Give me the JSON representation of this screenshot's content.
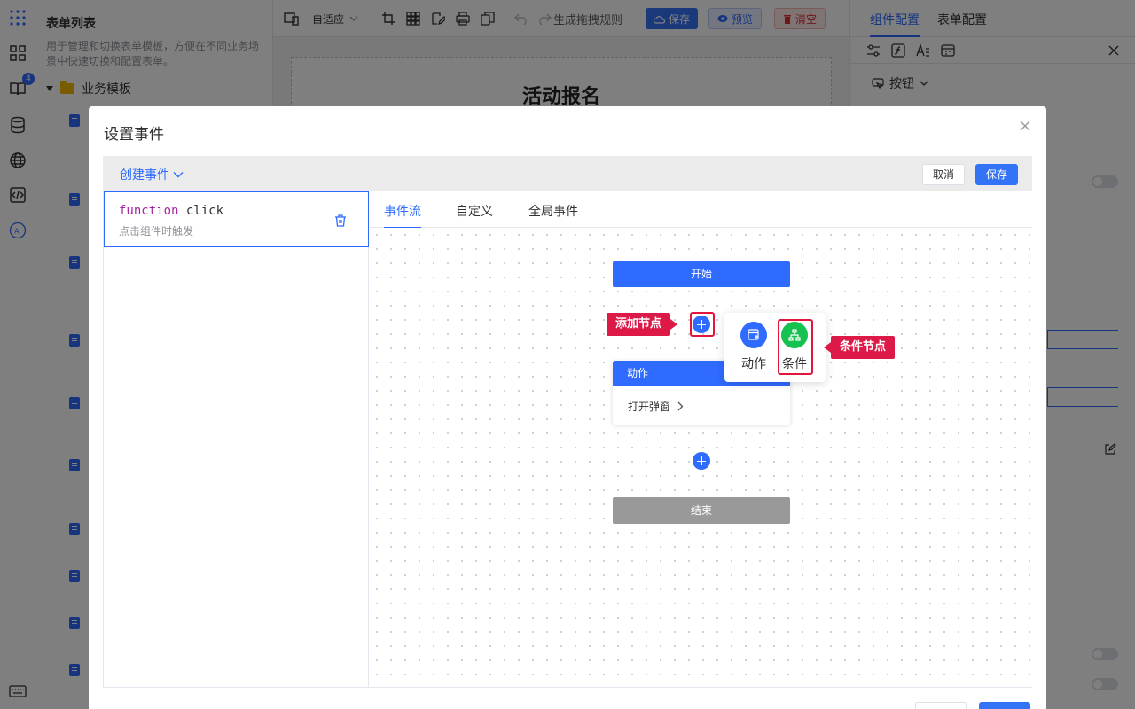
{
  "rail": {
    "badge_count": "4",
    "icons": [
      "apps-grid-icon",
      "widgets-icon",
      "book-icon",
      "database-icon",
      "globe-icon",
      "code-icon",
      "ai-icon",
      "keyboard-icon"
    ],
    "ai_label": "AI"
  },
  "form_list": {
    "title": "表单列表",
    "description": "用于管理和切换表单模板，方便在不同业务场景中快速切换和配置表单。",
    "folder_label": "业务模板"
  },
  "toolbar": {
    "layout_mode": "自适应",
    "generate_rule": "生成拖拽规则",
    "save": "保存",
    "preview": "预览",
    "clear": "清空"
  },
  "canvas": {
    "form_title": "活动报名"
  },
  "right_panel": {
    "tabs": [
      "组件配置",
      "表单配置"
    ],
    "component_type": "按钮"
  },
  "dialog": {
    "title": "设置事件",
    "create_event": "创建事件",
    "cancel": "取消",
    "save": "保存",
    "function": {
      "keyword": "function",
      "name": "click",
      "description": "点击组件时触发"
    },
    "flow_tabs": [
      "事件流",
      "自定义",
      "全局事件"
    ],
    "active_flow_tab": "事件流",
    "nodes": {
      "start": "开始",
      "action_header": "动作",
      "action_body": "打开弹窗",
      "end": "结束"
    },
    "popup": {
      "action": "动作",
      "condition": "条件"
    },
    "callouts": {
      "add_node": "添加节点",
      "condition_node": "条件节点"
    }
  },
  "colors": {
    "primary": "#2f6bff",
    "condition_green": "#15c24f",
    "callout_red": "#dd1a47",
    "end_gray": "#999999"
  }
}
